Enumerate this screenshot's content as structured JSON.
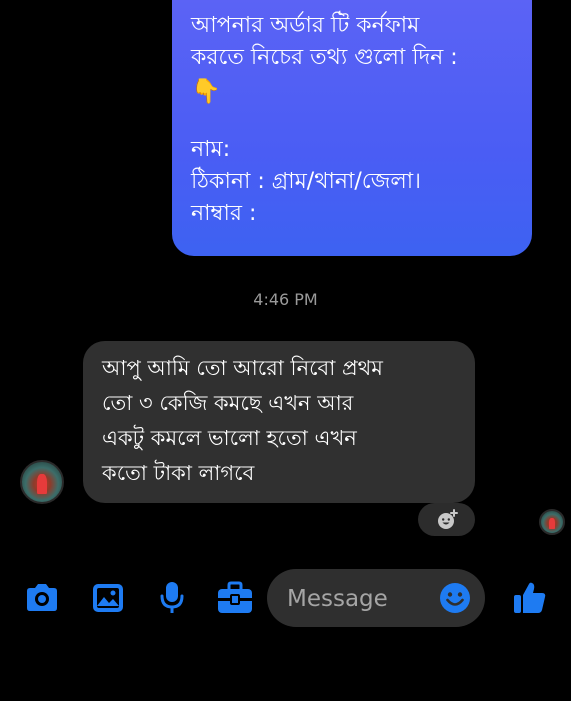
{
  "conversation": {
    "outgoing_message": {
      "lines": [
        "আপনার অর্ডার টি কর্নফাম",
        "করতে নিচের তথ্য গুলো দিন :",
        "👇",
        "নাম:",
        "ঠিকানা : গ্রাম/থানা/জেলা।",
        "নাম্বার :"
      ]
    },
    "timestamp": "4:46 PM",
    "incoming_message": {
      "lines": [
        "আপু আমি  তো আরো নিবো প্রথম",
        "তো ৩ কেজি  কমছে এখন আর",
        "একটু  কমলে ভালো  হতো  এখন",
        "কতো টাকা  লাগবে"
      ]
    }
  },
  "composer": {
    "placeholder": "Message",
    "icons": [
      "camera-icon",
      "gallery-icon",
      "microphone-icon",
      "briefcase-icon",
      "emoji-icon",
      "thumbs-up-icon"
    ],
    "accent_color": "#1e7bf2"
  },
  "colors": {
    "background": "#000000",
    "outgoing_bubble": "#4a5df4",
    "incoming_bubble": "#303030",
    "timestamp": "#9a9a9a"
  }
}
